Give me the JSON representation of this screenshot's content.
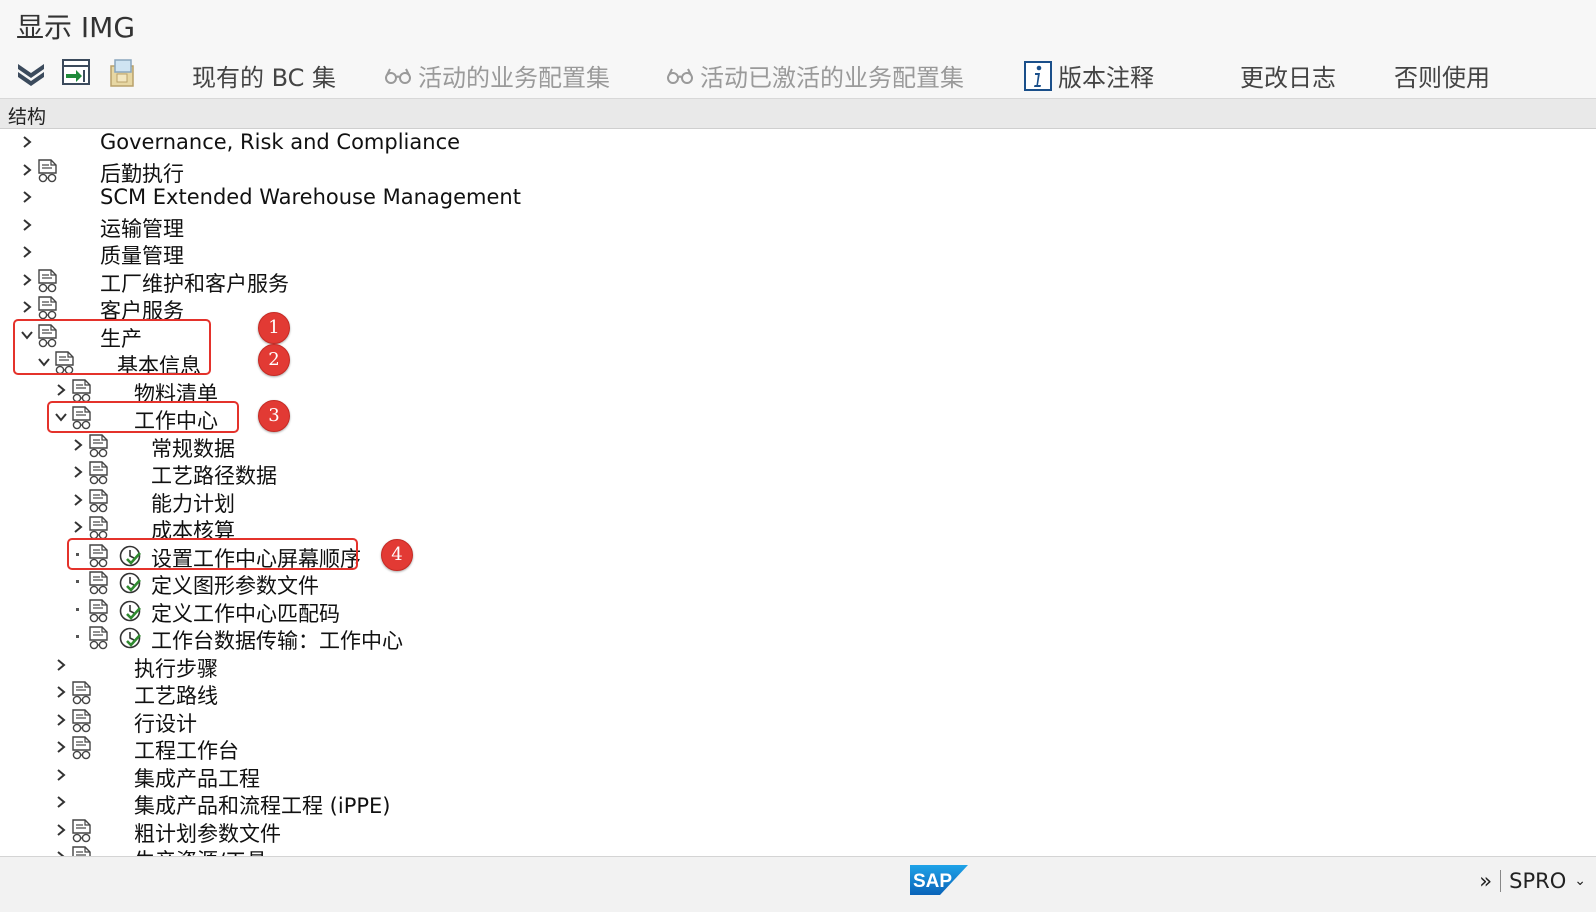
{
  "window": {
    "title": "显示 IMG"
  },
  "toolbar": {
    "buttons": [
      {
        "label": "现有的 BC 集",
        "enabled": true
      },
      {
        "label": "活动的业务配置集",
        "enabled": false
      },
      {
        "label": "活动已激活的业务配置集",
        "enabled": false
      },
      {
        "label": "版本注释",
        "enabled": true
      },
      {
        "label": "更改日志",
        "enabled": true
      },
      {
        "label": "否则使用",
        "enabled": true
      }
    ],
    "icons": [
      "expand-all-icon",
      "transfer-icon",
      "bc-set-icon"
    ]
  },
  "structure_header": {
    "label": "结构"
  },
  "tree": {
    "rows": [
      {
        "label": "Governance, Risk and Compliance",
        "level": 0,
        "expander": "collapsed",
        "doc": false,
        "exec": false
      },
      {
        "label": "后勤执行",
        "level": 0,
        "expander": "collapsed",
        "doc": true,
        "exec": false
      },
      {
        "label": "SCM Extended Warehouse Management",
        "level": 0,
        "expander": "collapsed",
        "doc": false,
        "exec": false
      },
      {
        "label": "运输管理",
        "level": 0,
        "expander": "collapsed",
        "doc": false,
        "exec": false
      },
      {
        "label": "质量管理",
        "level": 0,
        "expander": "collapsed",
        "doc": false,
        "exec": false
      },
      {
        "label": "工厂维护和客户服务",
        "level": 0,
        "expander": "collapsed",
        "doc": true,
        "exec": false
      },
      {
        "label": "客户服务",
        "level": 0,
        "expander": "collapsed",
        "doc": true,
        "exec": false
      },
      {
        "label": "生产",
        "level": 0,
        "expander": "expanded",
        "doc": true,
        "exec": false
      },
      {
        "label": "基本信息",
        "level": 1,
        "expander": "expanded",
        "doc": true,
        "exec": false
      },
      {
        "label": "物料清单",
        "level": 2,
        "expander": "collapsed",
        "doc": true,
        "exec": false
      },
      {
        "label": "工作中心",
        "level": 2,
        "expander": "expanded",
        "doc": true,
        "exec": false
      },
      {
        "label": "常规数据",
        "level": 3,
        "expander": "collapsed",
        "doc": true,
        "exec": false
      },
      {
        "label": "工艺路径数据",
        "level": 3,
        "expander": "collapsed",
        "doc": true,
        "exec": false
      },
      {
        "label": "能力计划",
        "level": 3,
        "expander": "collapsed",
        "doc": true,
        "exec": false
      },
      {
        "label": "成本核算",
        "level": 3,
        "expander": "collapsed",
        "doc": true,
        "exec": false
      },
      {
        "label": "设置工作中心屏幕顺序",
        "level": 3,
        "expander": "leaf",
        "doc": true,
        "exec": true
      },
      {
        "label": "定义图形参数文件",
        "level": 3,
        "expander": "leaf",
        "doc": true,
        "exec": true
      },
      {
        "label": "定义工作中心匹配码",
        "level": 3,
        "expander": "leaf",
        "doc": true,
        "exec": true
      },
      {
        "label": "工作台数据传输：工作中心",
        "level": 3,
        "expander": "leaf",
        "doc": true,
        "exec": true
      },
      {
        "label": "执行步骤",
        "level": 2,
        "expander": "collapsed",
        "doc": false,
        "exec": false
      },
      {
        "label": "工艺路线",
        "level": 2,
        "expander": "collapsed",
        "doc": true,
        "exec": false
      },
      {
        "label": "行设计",
        "level": 2,
        "expander": "collapsed",
        "doc": true,
        "exec": false
      },
      {
        "label": "工程工作台",
        "level": 2,
        "expander": "collapsed",
        "doc": true,
        "exec": false
      },
      {
        "label": "集成产品工程",
        "level": 2,
        "expander": "collapsed",
        "doc": false,
        "exec": false
      },
      {
        "label": "集成产品和流程工程 (iPPE)",
        "level": 2,
        "expander": "collapsed",
        "doc": false,
        "exec": false
      },
      {
        "label": "粗计划参数文件",
        "level": 2,
        "expander": "collapsed",
        "doc": true,
        "exec": false
      },
      {
        "label": "生产资源/工具",
        "level": 2,
        "expander": "collapsed",
        "doc": true,
        "exec": false
      }
    ]
  },
  "annotations": [
    {
      "number": "1",
      "rows": [
        7,
        8
      ]
    },
    {
      "number": "2",
      "rows": [
        8
      ]
    },
    {
      "number": "3",
      "rows": [
        10
      ]
    },
    {
      "number": "4",
      "rows": [
        15
      ]
    }
  ],
  "statusbar": {
    "logo": "SAP",
    "chevrons": "»",
    "transaction": "SPRO"
  },
  "colors": {
    "highlight": "#e4322b",
    "badge": "#e23a34",
    "exec_icon": "#2f8a2f"
  }
}
